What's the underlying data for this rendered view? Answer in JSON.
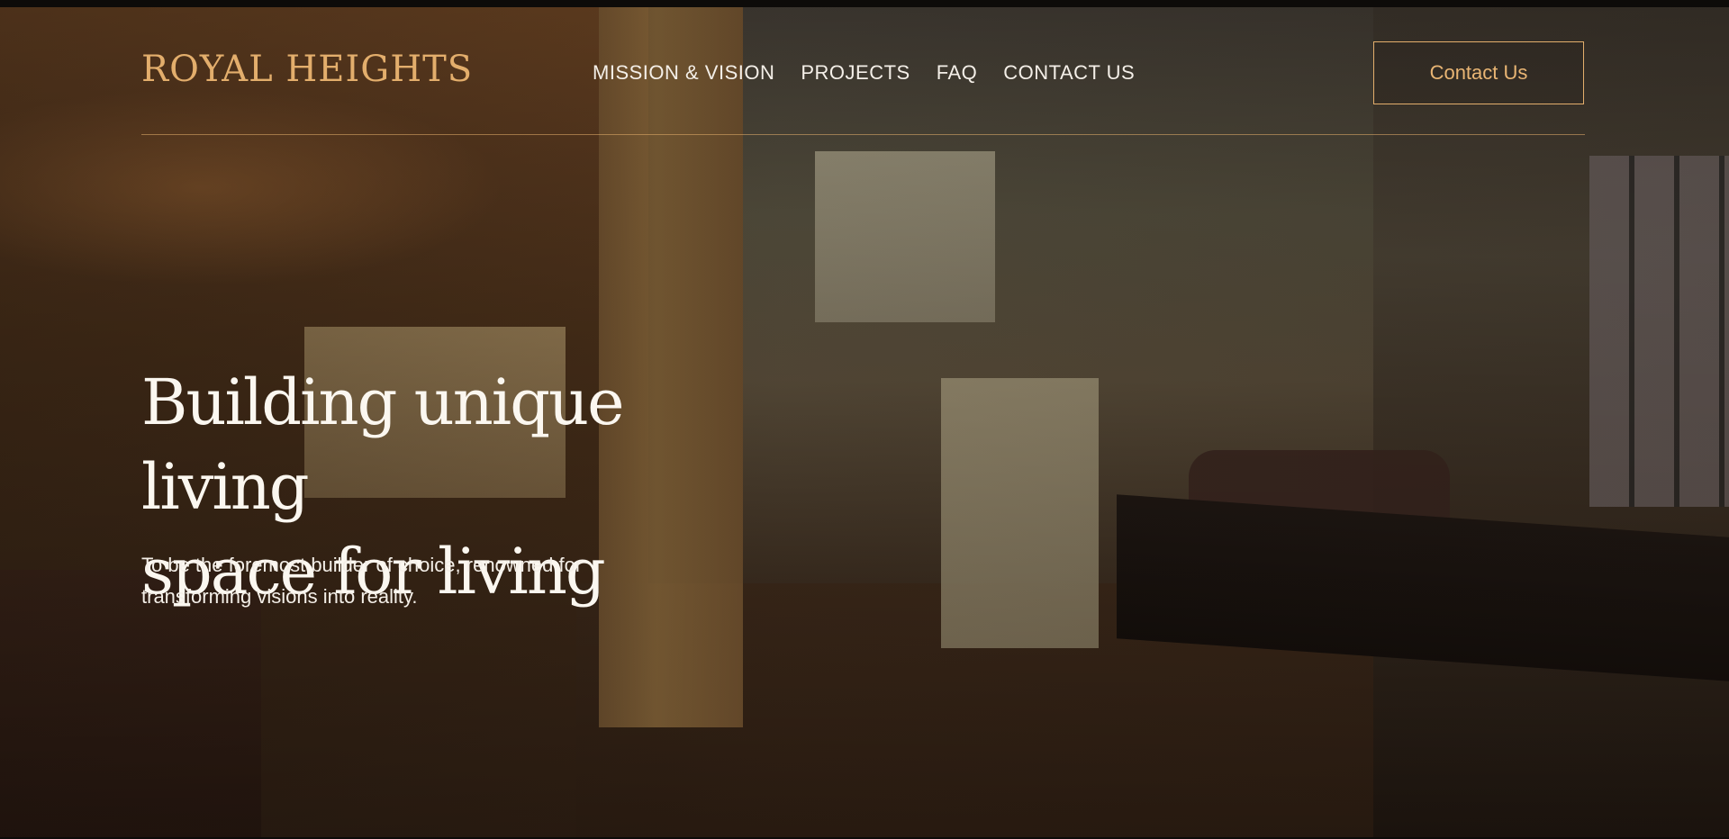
{
  "brand": {
    "name": "ROYAL HEIGHTS",
    "accent_color": "#e3ae6c"
  },
  "nav": {
    "items": [
      {
        "label": "MISSION & VISION"
      },
      {
        "label": "PROJECTS"
      },
      {
        "label": "FAQ"
      },
      {
        "label": "CONTACT US"
      }
    ]
  },
  "cta": {
    "label": "Contact Us"
  },
  "hero": {
    "headline_line1": "Building unique living",
    "headline_line2": "space for living",
    "subtext": "To be the foremost builder of choice, renowned for transforming visions into reality."
  }
}
